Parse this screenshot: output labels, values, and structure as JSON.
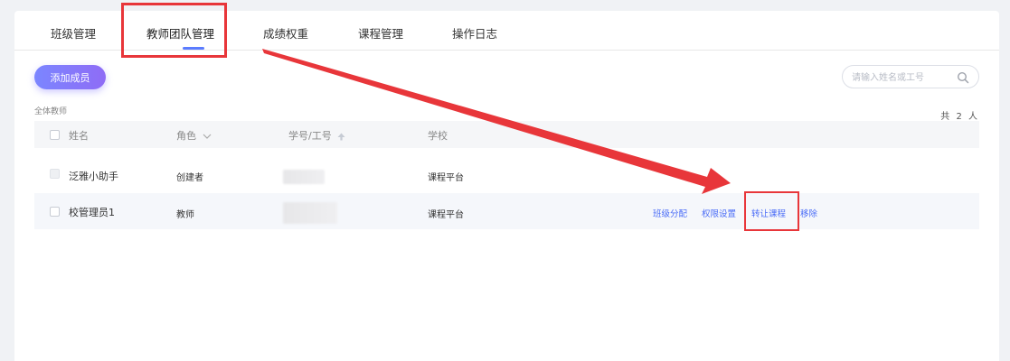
{
  "tabs": [
    {
      "label": "班级管理"
    },
    {
      "label": "教师团队管理"
    },
    {
      "label": "成绩权重"
    },
    {
      "label": "课程管理"
    },
    {
      "label": "操作日志"
    }
  ],
  "toolbar": {
    "add_label": "添加成员"
  },
  "search": {
    "placeholder": "请输入姓名或工号"
  },
  "group_label": "全体教师",
  "total_text": "共 2 人",
  "table": {
    "headers": {
      "name": "姓名",
      "role": "角色",
      "id": "学号/工号",
      "school": "学校"
    },
    "rows": [
      {
        "name": "泛雅小助手",
        "role": "创建者",
        "school": "课程平台"
      },
      {
        "name": "校管理员1",
        "role": "教师",
        "school": "课程平台",
        "ops": {
          "class_assign": "班级分配",
          "permission": "权限设置",
          "transfer": "转让课程",
          "remove": "移除"
        }
      }
    ]
  },
  "colors": {
    "accent": "#4a6cf7",
    "highlight_red": "#e8363a",
    "button_start": "#7b86ff",
    "button_end": "#8f6cf6"
  }
}
